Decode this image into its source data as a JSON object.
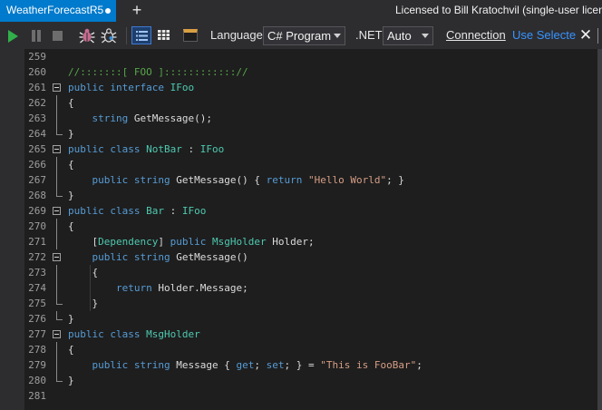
{
  "tab": {
    "title": "WeatherForecastR5",
    "add": "+"
  },
  "license": "Licensed to Bill Kratochvil (single-user licen",
  "toolbar": {
    "language_label": "Language",
    "language_value": "C# Program",
    "net_label": ".NET",
    "net_value": "Auto",
    "connection": "Connection",
    "use_selected": "Use Selecte",
    "close": "✕"
  },
  "icons": [
    "play-icon",
    "pause-icon",
    "stop-icon",
    "bug-icon",
    "bug-outline-icon",
    "rich-text-view-icon",
    "grid-view-icon",
    "results-panel-icon"
  ],
  "colors": {
    "tab_accent": "#007acc",
    "play": "#31b04a",
    "keyword": "#569cd6",
    "type": "#4ec9b0",
    "string": "#d69d85",
    "comment": "#57a64a"
  },
  "code_lines": [
    {
      "n": "259",
      "t": []
    },
    {
      "n": "260",
      "t": [
        [
          "cm",
          "//:::::::[ FOO ]:::::::::::://"
        ]
      ]
    },
    {
      "n": "261",
      "t": [
        [
          "kw",
          "public"
        ],
        [
          "p",
          " "
        ],
        [
          "kw",
          "interface"
        ],
        [
          "p",
          " "
        ],
        [
          "ty",
          "IFoo"
        ]
      ]
    },
    {
      "n": "262",
      "t": [
        [
          "p",
          "{"
        ]
      ]
    },
    {
      "n": "263",
      "t": [
        [
          "p",
          "    "
        ],
        [
          "kw",
          "string"
        ],
        [
          "p",
          " GetMessage();"
        ]
      ]
    },
    {
      "n": "264",
      "t": [
        [
          "p",
          "}"
        ]
      ]
    },
    {
      "n": "265",
      "t": [
        [
          "kw",
          "public"
        ],
        [
          "p",
          " "
        ],
        [
          "kw",
          "class"
        ],
        [
          "p",
          " "
        ],
        [
          "ty",
          "NotBar"
        ],
        [
          "p",
          " : "
        ],
        [
          "ty",
          "IFoo"
        ]
      ]
    },
    {
      "n": "266",
      "t": [
        [
          "p",
          "{"
        ]
      ]
    },
    {
      "n": "267",
      "t": [
        [
          "p",
          "    "
        ],
        [
          "kw",
          "public"
        ],
        [
          "p",
          " "
        ],
        [
          "kw",
          "string"
        ],
        [
          "p",
          " GetMessage() { "
        ],
        [
          "kw",
          "return"
        ],
        [
          "p",
          " "
        ],
        [
          "str",
          "\"Hello World\""
        ],
        [
          "p",
          "; }"
        ]
      ]
    },
    {
      "n": "268",
      "t": [
        [
          "p",
          "}"
        ]
      ]
    },
    {
      "n": "269",
      "t": [
        [
          "kw",
          "public"
        ],
        [
          "p",
          " "
        ],
        [
          "kw",
          "class"
        ],
        [
          "p",
          " "
        ],
        [
          "ty",
          "Bar"
        ],
        [
          "p",
          " : "
        ],
        [
          "ty",
          "IFoo"
        ]
      ]
    },
    {
      "n": "270",
      "t": [
        [
          "p",
          "{"
        ]
      ]
    },
    {
      "n": "271",
      "t": [
        [
          "p",
          "    ["
        ],
        [
          "ty",
          "Dependency"
        ],
        [
          "p",
          "] "
        ],
        [
          "kw",
          "public"
        ],
        [
          "p",
          " "
        ],
        [
          "ty",
          "MsgHolder"
        ],
        [
          "p",
          " Holder;"
        ]
      ]
    },
    {
      "n": "272",
      "t": [
        [
          "p",
          "    "
        ],
        [
          "kw",
          "public"
        ],
        [
          "p",
          " "
        ],
        [
          "kw",
          "string"
        ],
        [
          "p",
          " GetMessage()"
        ]
      ]
    },
    {
      "n": "273",
      "t": [
        [
          "p",
          "    {"
        ]
      ]
    },
    {
      "n": "274",
      "t": [
        [
          "p",
          "        "
        ],
        [
          "kw",
          "return"
        ],
        [
          "p",
          " Holder.Message;"
        ]
      ]
    },
    {
      "n": "275",
      "t": [
        [
          "p",
          "    }"
        ]
      ]
    },
    {
      "n": "276",
      "t": [
        [
          "p",
          "}"
        ]
      ]
    },
    {
      "n": "277",
      "t": [
        [
          "kw",
          "public"
        ],
        [
          "p",
          " "
        ],
        [
          "kw",
          "class"
        ],
        [
          "p",
          " "
        ],
        [
          "ty",
          "MsgHolder"
        ]
      ]
    },
    {
      "n": "278",
      "t": [
        [
          "p",
          "{"
        ]
      ]
    },
    {
      "n": "279",
      "t": [
        [
          "p",
          "    "
        ],
        [
          "kw",
          "public"
        ],
        [
          "p",
          " "
        ],
        [
          "kw",
          "string"
        ],
        [
          "p",
          " Message { "
        ],
        [
          "kw",
          "get"
        ],
        [
          "p",
          "; "
        ],
        [
          "kw",
          "set"
        ],
        [
          "p",
          "; } = "
        ],
        [
          "str",
          "\"This is FooBar\""
        ],
        [
          "p",
          ";"
        ]
      ]
    },
    {
      "n": "280",
      "t": [
        [
          "p",
          "}"
        ]
      ]
    },
    {
      "n": "281",
      "t": []
    }
  ],
  "folding": {
    "261": "start",
    "262": "mid",
    "263": "mid",
    "264": "end",
    "265": "start",
    "266": "mid",
    "267": "mid",
    "268": "end",
    "269": "start",
    "270": "mid",
    "271": "mid",
    "272": "start",
    "273": "mid",
    "274": "mid",
    "275": "end",
    "276": "end",
    "277": "start",
    "278": "mid",
    "279": "mid",
    "280": "end"
  }
}
